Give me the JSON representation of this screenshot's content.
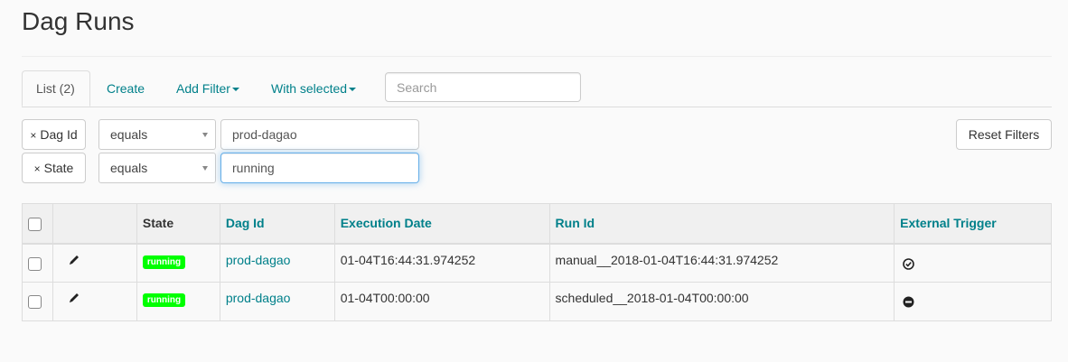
{
  "page": {
    "title": "Dag Runs"
  },
  "tabs": {
    "list": "List (2)",
    "create": "Create",
    "add_filter": "Add Filter",
    "with_selected": "With selected"
  },
  "search": {
    "placeholder": "Search"
  },
  "filters": [
    {
      "field": "Dag Id",
      "operator": "equals",
      "value": "prod-dagao",
      "remove": "×"
    },
    {
      "field": "State",
      "operator": "equals",
      "value": "running",
      "remove": "×"
    }
  ],
  "reset_label": "Reset Filters",
  "table": {
    "headers": [
      "State",
      "Dag Id",
      "Execution Date",
      "Run Id",
      "External Trigger"
    ],
    "rows": [
      {
        "state": "running",
        "dag_id": "prod-dagao",
        "execution_date": "01-04T16:44:31.974252",
        "run_id": "manual__2018-01-04T16:44:31.974252",
        "external_trigger": "check-circle-icon"
      },
      {
        "state": "running",
        "dag_id": "prod-dagao",
        "execution_date": "01-04T00:00:00",
        "run_id": "scheduled__2018-01-04T00:00:00",
        "external_trigger": "minus-circle-icon"
      }
    ]
  },
  "colors": {
    "link": "#00808a",
    "running": "#00ff00",
    "focus": "#66afe9"
  }
}
